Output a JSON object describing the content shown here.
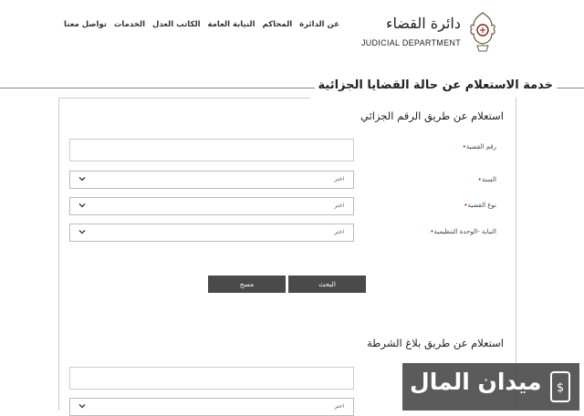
{
  "header": {
    "logo_ar": "دائرة القضاء",
    "logo_en": "JUDICIAL DEPARTMENT",
    "nav": [
      {
        "label": "عن الدائرة"
      },
      {
        "label": "المحاكم"
      },
      {
        "label": "النيابة العامة"
      },
      {
        "label": "الكاتب العدل"
      },
      {
        "label": "الخدمات"
      },
      {
        "label": "تواصل معنا"
      }
    ]
  },
  "page": {
    "title": "خدمة الاستعلام عن حالة القضايا الجزائية"
  },
  "section1": {
    "heading": "استعلام عن طريق الرقم الجزائي",
    "case_number_label": "رقم القضية",
    "year_label": "السنة",
    "year_value": "اختر",
    "case_type_label": "نوع القضية",
    "case_type_value": "اختر",
    "prosecution_label": "النيابة -الوحدة التنظيمية",
    "prosecution_value": "اختر",
    "search_label": "البحث",
    "clear_label": "مسح"
  },
  "section2": {
    "heading": "استعلام عن طريق بلاغ الشرطة",
    "select_value": "اختر"
  },
  "watermark": {
    "text": "ميدان المال"
  },
  "colors": {
    "button": "#4a4a4a",
    "required_dot": "#c8102e",
    "watermark_bg": "#373737"
  }
}
